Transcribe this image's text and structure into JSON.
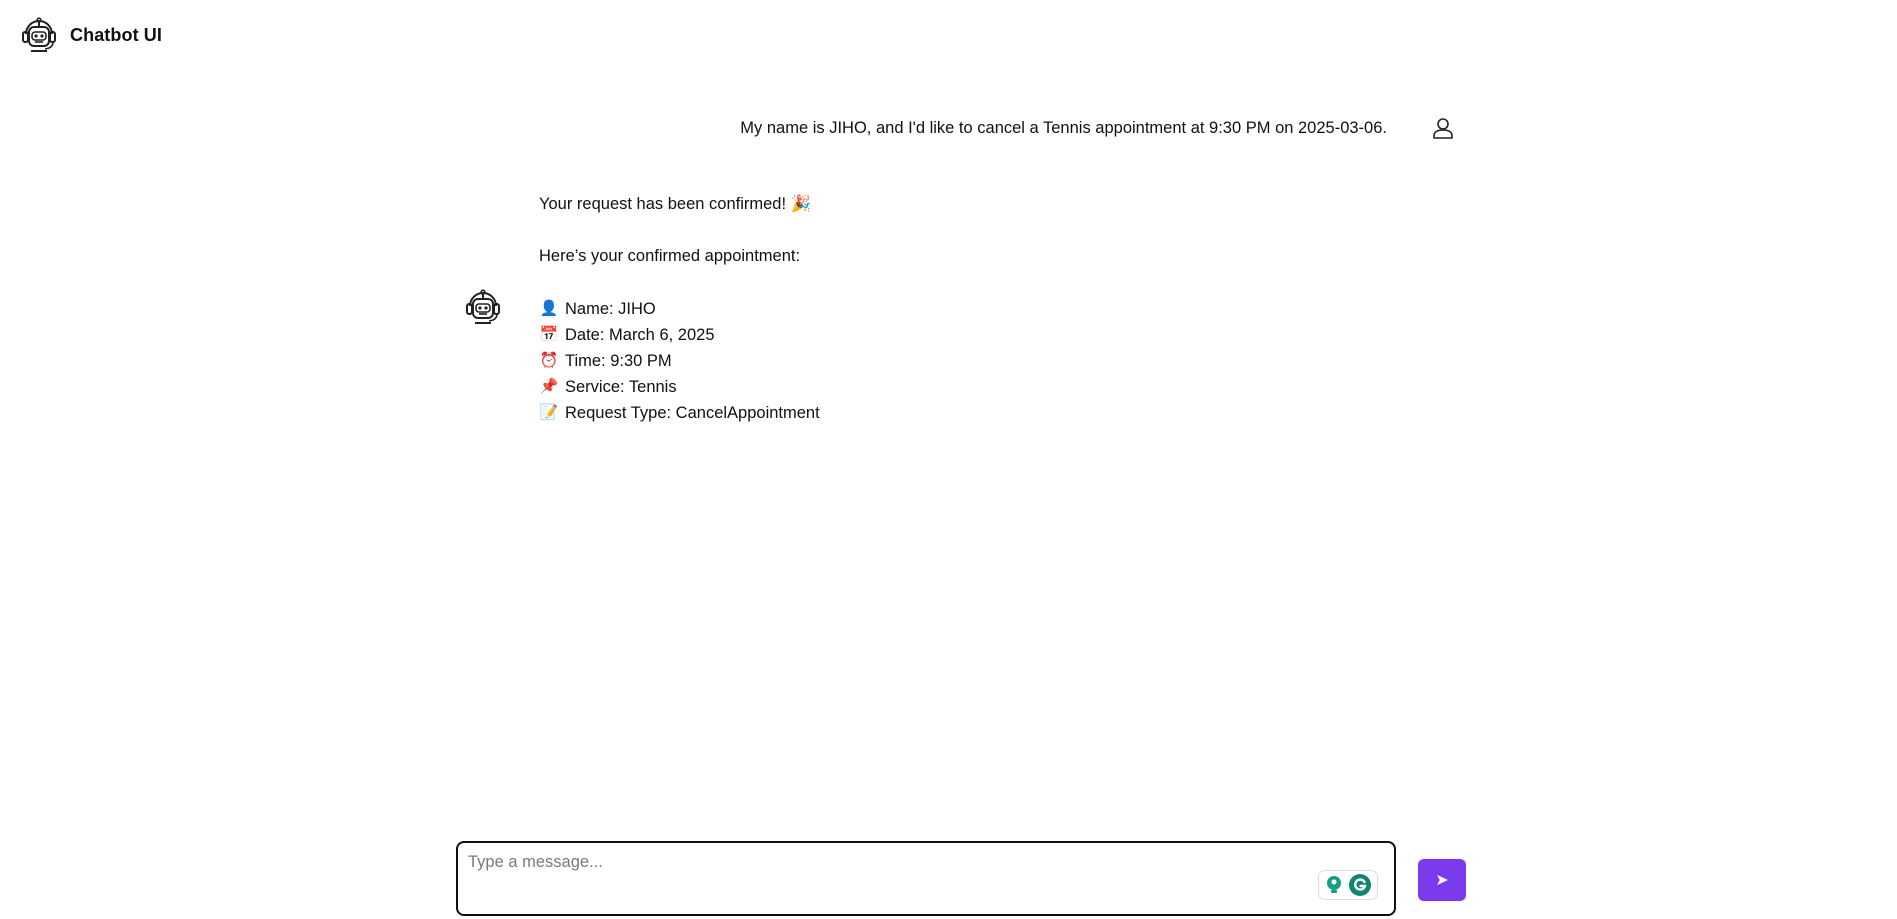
{
  "app": {
    "title": "Chatbot UI"
  },
  "messages": {
    "user": {
      "text": "My name is JIHO, and I'd like to cancel a Tennis appointment at 9:30 PM on 2025-03-06."
    },
    "bot": {
      "confirmation": "Your request has been confirmed! 🎉",
      "intro": "Here’s your confirmed appointment:",
      "details": [
        {
          "emoji": "👤",
          "text": "Name: JIHO"
        },
        {
          "emoji": "📅",
          "text": "Date: March 6, 2025"
        },
        {
          "emoji": "⏰",
          "text": "Time: 9:30 PM"
        },
        {
          "emoji": "📌",
          "text": "Service: Tennis"
        },
        {
          "emoji": "📝",
          "text": "Request Type: CancelAppointment"
        }
      ]
    }
  },
  "composer": {
    "placeholder": "Type a message...",
    "value": "",
    "send_label": "➤"
  },
  "colors": {
    "accent": "#7c3aed",
    "grammarly_green": "#15a085"
  }
}
